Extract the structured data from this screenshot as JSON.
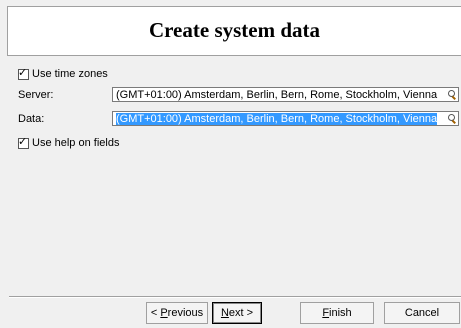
{
  "header": {
    "title": "Create system data"
  },
  "options": {
    "use_time_zones": {
      "label": "Use time zones",
      "checked": true
    },
    "use_help": {
      "label": "Use help on fields",
      "checked": true
    }
  },
  "fields": {
    "server": {
      "label": "Server:",
      "value": "(GMT+01:00) Amsterdam, Berlin, Bern, Rome, Stockholm, Vienna",
      "icon": "lookup-icon"
    },
    "data": {
      "label": "Data:",
      "value": "(GMT+01:00) Amsterdam, Berlin, Bern, Rome, Stockholm, Vienna",
      "icon": "lookup-icon"
    }
  },
  "buttons": {
    "previous_prefix": "< ",
    "previous_key": "P",
    "previous_rest": "revious",
    "next_key": "N",
    "next_rest": "ext >",
    "finish_key": "F",
    "finish_rest": "inish",
    "cancel": "Cancel"
  },
  "colors": {
    "selection": "#3399ff",
    "background": "#f0f0f0"
  }
}
